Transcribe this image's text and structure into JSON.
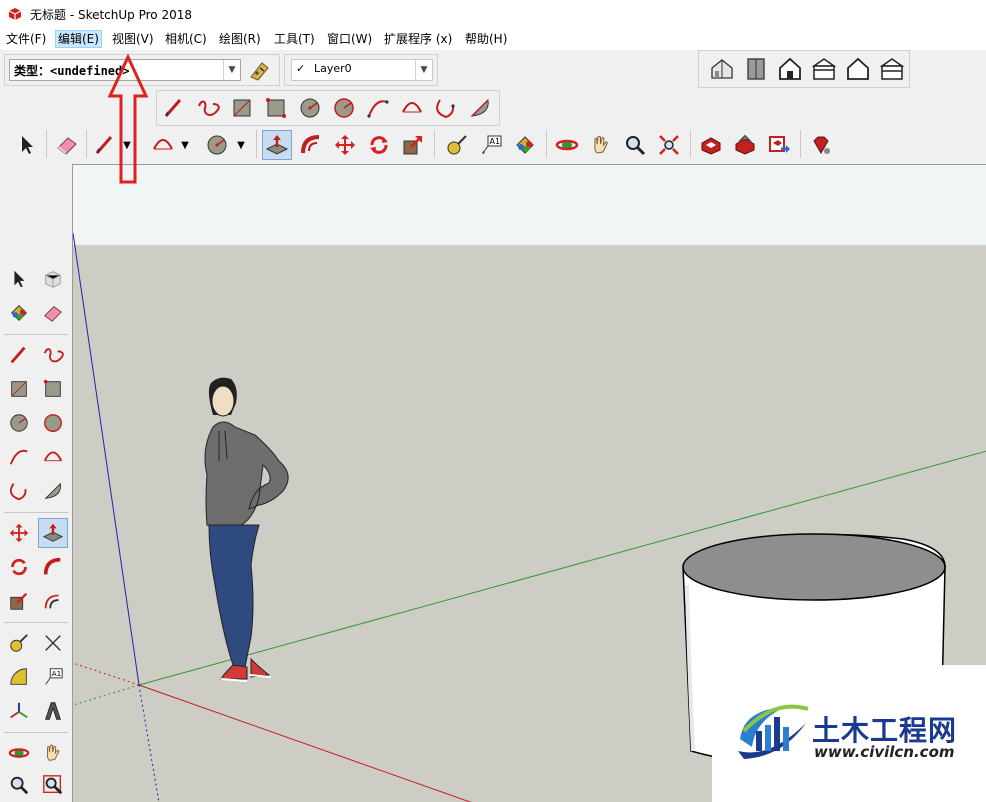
{
  "window": {
    "title": "无标题 - SketchUp Pro 2018"
  },
  "menu": {
    "items": [
      {
        "id": "file",
        "label": "文件(F)"
      },
      {
        "id": "edit",
        "label": "编辑(E)",
        "active": true
      },
      {
        "id": "view",
        "label": "视图(V)"
      },
      {
        "id": "camera",
        "label": "相机(C)"
      },
      {
        "id": "draw",
        "label": "绘图(R)"
      },
      {
        "id": "tools",
        "label": "工具(T)"
      },
      {
        "id": "window",
        "label": "窗口(W)"
      },
      {
        "id": "extensions",
        "label": "扩展程序 (x)"
      },
      {
        "id": "help",
        "label": "帮助(H)"
      }
    ]
  },
  "styles_toolbar": {
    "type_value": "类型：<undefined>"
  },
  "layers_toolbar": {
    "check": "✓",
    "layer_value": "Layer0"
  },
  "watermark": {
    "title": "土木工程网",
    "url": "www.civilcn.com"
  },
  "colors": {
    "sky": "#f2f5f6",
    "ground": "#cdcdc6",
    "axis_red": "#c21c1c",
    "axis_green": "#2d9a2d",
    "axis_blue": "#2222aa",
    "annotation_red": "#e02020",
    "icon_red": "#d32020",
    "brand_blue": "#1a3a8f"
  }
}
